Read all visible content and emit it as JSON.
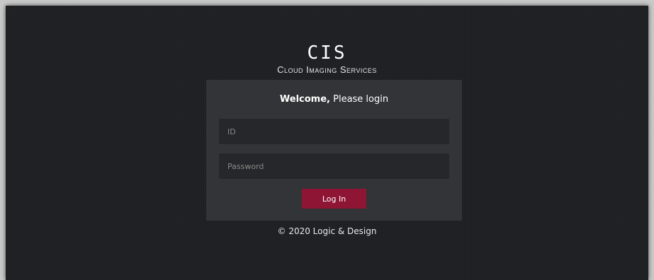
{
  "brand": {
    "logo": "CIS",
    "tagline": "Cloud Imaging Services"
  },
  "login": {
    "welcome_bold": "Welcome,",
    "welcome_rest": " Please login",
    "id_placeholder": "ID",
    "password_placeholder": "Password",
    "button_label": "Log In"
  },
  "footer": {
    "copyright": "© 2020 Logic & Design"
  },
  "colors": {
    "background": "#1e1f22",
    "panel": "#333437",
    "input": "#26272a",
    "button": "#8e1533"
  }
}
